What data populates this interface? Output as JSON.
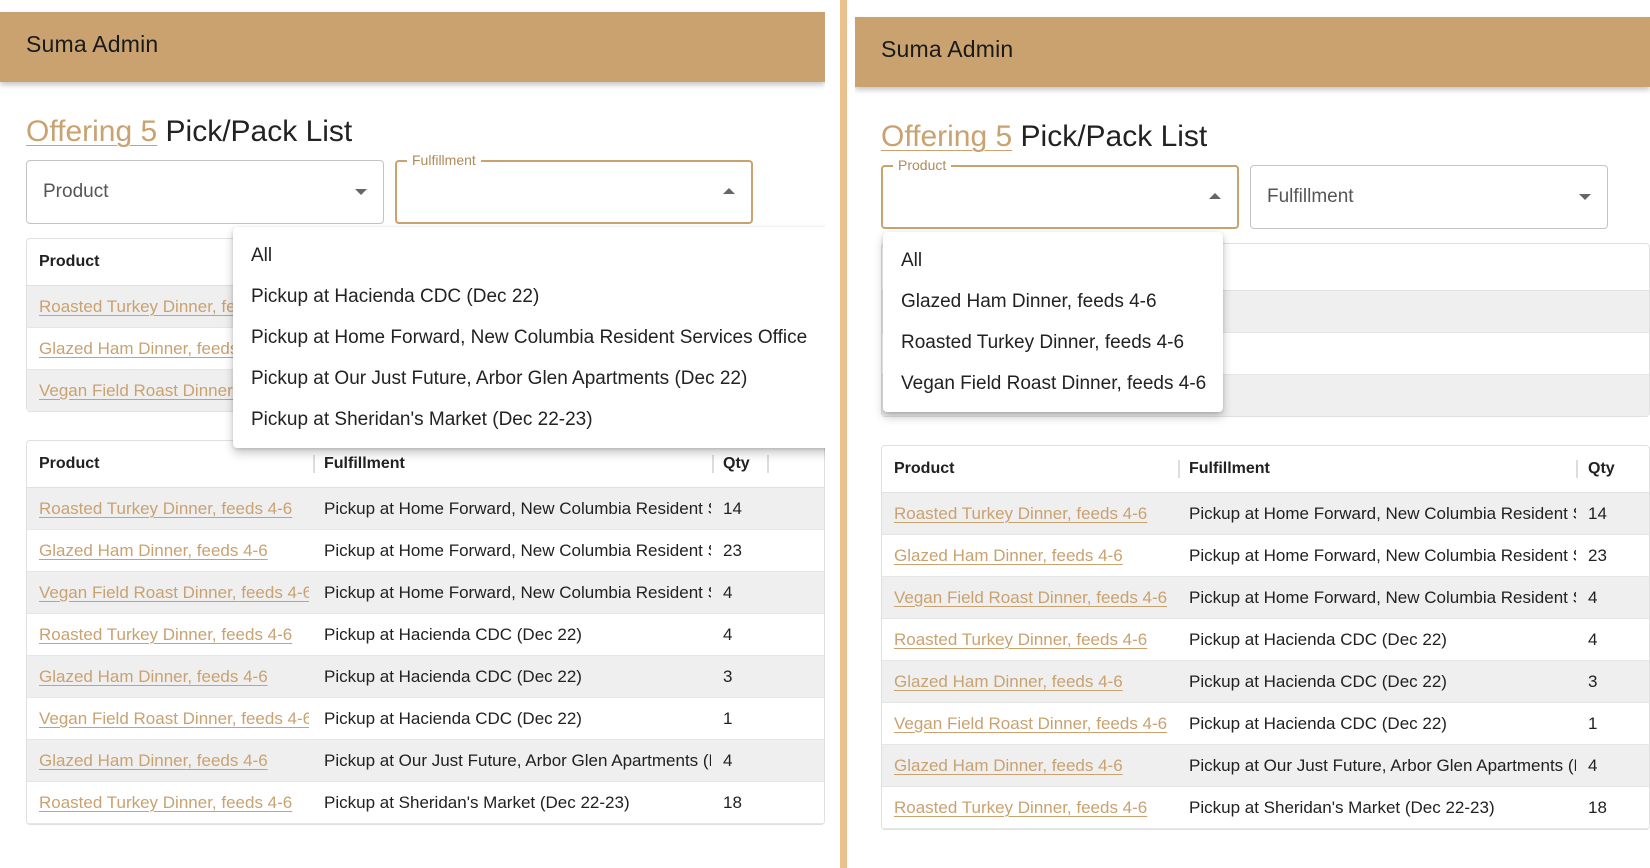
{
  "app_title": "Suma Admin",
  "page": {
    "offering_link": "Offering 5",
    "title_rest": " Pick/Pack List"
  },
  "columns": {
    "product": "Product",
    "fulfillment": "Fulfillment",
    "qty": "Qty"
  },
  "left_panel": {
    "product_select": {
      "value": "Product"
    },
    "fulfillment_select": {
      "label": "Fulfillment",
      "value": ""
    },
    "menu": [
      "All",
      "Pickup at Hacienda CDC (Dec 22)",
      "Pickup at Home Forward, New Columbia Resident Services Office",
      "Pickup at Our Just Future, Arbor Glen Apartments (Dec 22)",
      "Pickup at Sheridan's Market (Dec 22-23)"
    ],
    "summary_rows": [
      "Roasted Turkey Dinner, fe",
      "Glazed Ham Dinner, feeds",
      "Vegan Field Roast Dinner,"
    ]
  },
  "right_panel": {
    "product_select": {
      "label": "Product",
      "value": ""
    },
    "fulfillment_select": {
      "value": "Fulfillment"
    },
    "menu": [
      "All",
      "Glazed Ham Dinner, feeds 4-6",
      "Roasted Turkey Dinner, feeds 4-6",
      "Vegan Field Roast Dinner, feeds 4-6"
    ]
  },
  "pick_rows": [
    {
      "product": "Roasted Turkey Dinner, feeds 4-6",
      "fulfillment": "Pickup at Home Forward, New Columbia Resident Ser",
      "qty": "14"
    },
    {
      "product": "Glazed Ham Dinner, feeds 4-6",
      "fulfillment": "Pickup at Home Forward, New Columbia Resident Ser",
      "qty": "23"
    },
    {
      "product": "Vegan Field Roast Dinner, feeds 4-6",
      "fulfillment": "Pickup at Home Forward, New Columbia Resident Ser",
      "qty": "4"
    },
    {
      "product": "Roasted Turkey Dinner, feeds 4-6",
      "fulfillment": "Pickup at Hacienda CDC (Dec 22)",
      "qty": "4"
    },
    {
      "product": "Glazed Ham Dinner, feeds 4-6",
      "fulfillment": "Pickup at Hacienda CDC (Dec 22)",
      "qty": "3"
    },
    {
      "product": "Vegan Field Roast Dinner, feeds 4-6",
      "fulfillment": "Pickup at Hacienda CDC (Dec 22)",
      "qty": "1"
    },
    {
      "product": "Glazed Ham Dinner, feeds 4-6",
      "fulfillment": "Pickup at Our Just Future, Arbor Glen Apartments (De",
      "qty": "4"
    },
    {
      "product": "Roasted Turkey Dinner, feeds 4-6",
      "fulfillment": "Pickup at Sheridan's Market (Dec 22-23)",
      "qty": "18"
    }
  ],
  "colors": {
    "header": "#c9a270",
    "accent": "#c9a270",
    "divider": "#eac08c"
  }
}
